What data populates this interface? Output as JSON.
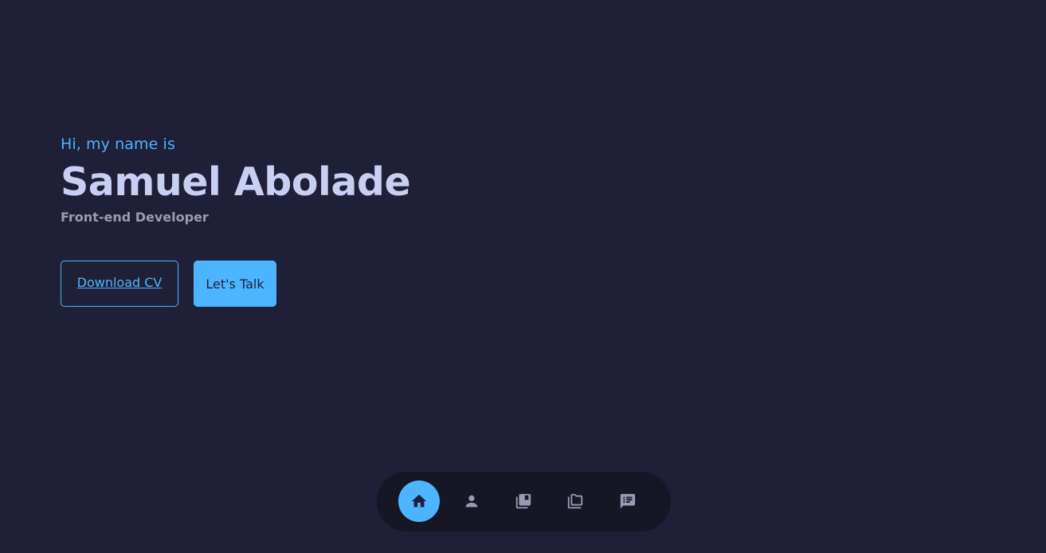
{
  "hero": {
    "greeting": "Hi, my name is",
    "name": "Samuel Abolade",
    "role": "Front-end Developer"
  },
  "cta": {
    "download_label": "Download CV",
    "talk_label": "Let's Talk"
  },
  "nav": {
    "items": [
      {
        "icon": "home-icon",
        "active": true
      },
      {
        "icon": "person-icon",
        "active": false
      },
      {
        "icon": "library-icon",
        "active": false
      },
      {
        "icon": "folders-icon",
        "active": false
      },
      {
        "icon": "message-icon",
        "active": false
      }
    ]
  },
  "colors": {
    "background": "#1f1f38",
    "accent": "#4db5ff",
    "heading": "#c9cff2",
    "muted": "#999ab3",
    "nav_bg": "#161624",
    "nav_icon": "#999ab3"
  }
}
